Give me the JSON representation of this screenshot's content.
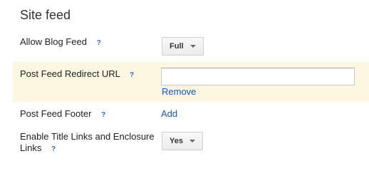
{
  "section": {
    "title": "Site feed"
  },
  "help_glyph": "?",
  "rows": {
    "allow_blog_feed": {
      "label": "Allow Blog Feed",
      "value": "Full"
    },
    "post_feed_redirect": {
      "label": "Post Feed Redirect URL",
      "input_value": "",
      "remove_label": "Remove"
    },
    "post_feed_footer": {
      "label": "Post Feed Footer",
      "add_label": "Add"
    },
    "title_links": {
      "label_line1": "Enable Title Links and Enclosure",
      "label_line2": "Links",
      "value": "Yes"
    }
  },
  "colors": {
    "highlight": "#fdf6e1",
    "link": "#1155cc"
  }
}
